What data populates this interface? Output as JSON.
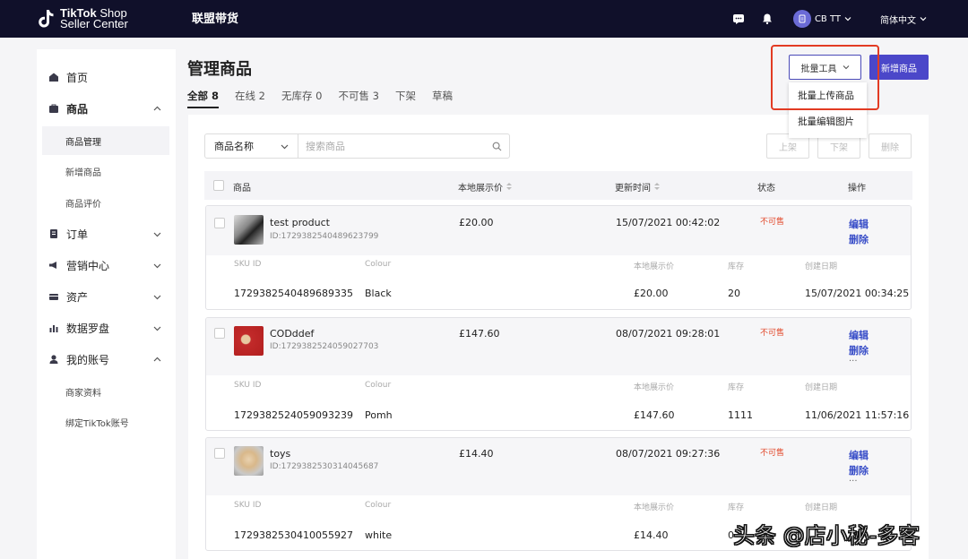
{
  "topbar": {
    "logo_line1_bold": "TikTok",
    "logo_line1_rest": " Shop",
    "logo_line2": "Seller Center",
    "title": "联盟带货",
    "account_name": "CB TT",
    "language": "简体中文",
    "icons": [
      "chat-icon",
      "bell-icon",
      "avatar-icon",
      "chevron-down-icon"
    ]
  },
  "sidebar": {
    "home": "首页",
    "products": "商品",
    "product_manage": "商品管理",
    "product_add": "新增商品",
    "product_review": "商品评价",
    "orders": "订单",
    "marketing": "营销中心",
    "assets": "资产",
    "data": "数据罗盘",
    "account": "我的账号",
    "merchant_info": "商家资料",
    "bind_tiktok": "绑定TikTok账号"
  },
  "main": {
    "title": "管理商品",
    "tabs": [
      {
        "label": "全部 8"
      },
      {
        "label": "在线 2"
      },
      {
        "label": "无库存 0"
      },
      {
        "label": "不可售 3"
      },
      {
        "label": "下架"
      },
      {
        "label": "草稿"
      }
    ],
    "batch_tools": "批量工具",
    "new_product": "新增商品",
    "dropdown": [
      "批量上传商品",
      "批量编辑图片"
    ],
    "filter_select": "商品名称",
    "search_placeholder": "搜索商品",
    "actions": [
      "上架",
      "下架",
      "删除"
    ],
    "columns": {
      "product": "商品",
      "price": "本地展示价",
      "updated": "更新时间",
      "status": "状态",
      "ops": "操作"
    },
    "sku_columns": {
      "sku_id": "SKU ID",
      "colour": "Colour",
      "price": "本地展示价",
      "stock": "库存",
      "created": "创建日期"
    },
    "edit": "编辑",
    "delete": "删除",
    "more": "...",
    "products": [
      {
        "name": "test product",
        "id": "ID:1729382540489623799",
        "price": "£20.00",
        "updated": "15/07/2021 00:42:02",
        "status": "不可售",
        "sku": {
          "id": "1729382540489689335",
          "colour": "Black",
          "price": "£20.00",
          "stock": "20",
          "created": "15/07/2021 00:34:25"
        }
      },
      {
        "name": "CODddef",
        "id": "ID:1729382524059027703",
        "price": "£147.60",
        "updated": "08/07/2021 09:28:01",
        "status": "不可售",
        "sku": {
          "id": "1729382524059093239",
          "colour": "Pomh",
          "price": "£147.60",
          "stock": "1111",
          "created": "11/06/2021 11:57:16"
        }
      },
      {
        "name": "toys",
        "id": "ID:1729382530314045687",
        "price": "£14.40",
        "updated": "08/07/2021 09:27:36",
        "status": "不可售",
        "sku": {
          "id": "1729382530410055927",
          "colour": "white",
          "price": "£14.40",
          "stock": "0",
          "created": ""
        }
      }
    ]
  },
  "watermark": "头条 @店小秘-多客",
  "colors": {
    "topbar": "#10102a",
    "primary": "#4b47c9",
    "link": "#3a4fc8",
    "status": "#e2482a",
    "highlight": "#e23b23"
  }
}
